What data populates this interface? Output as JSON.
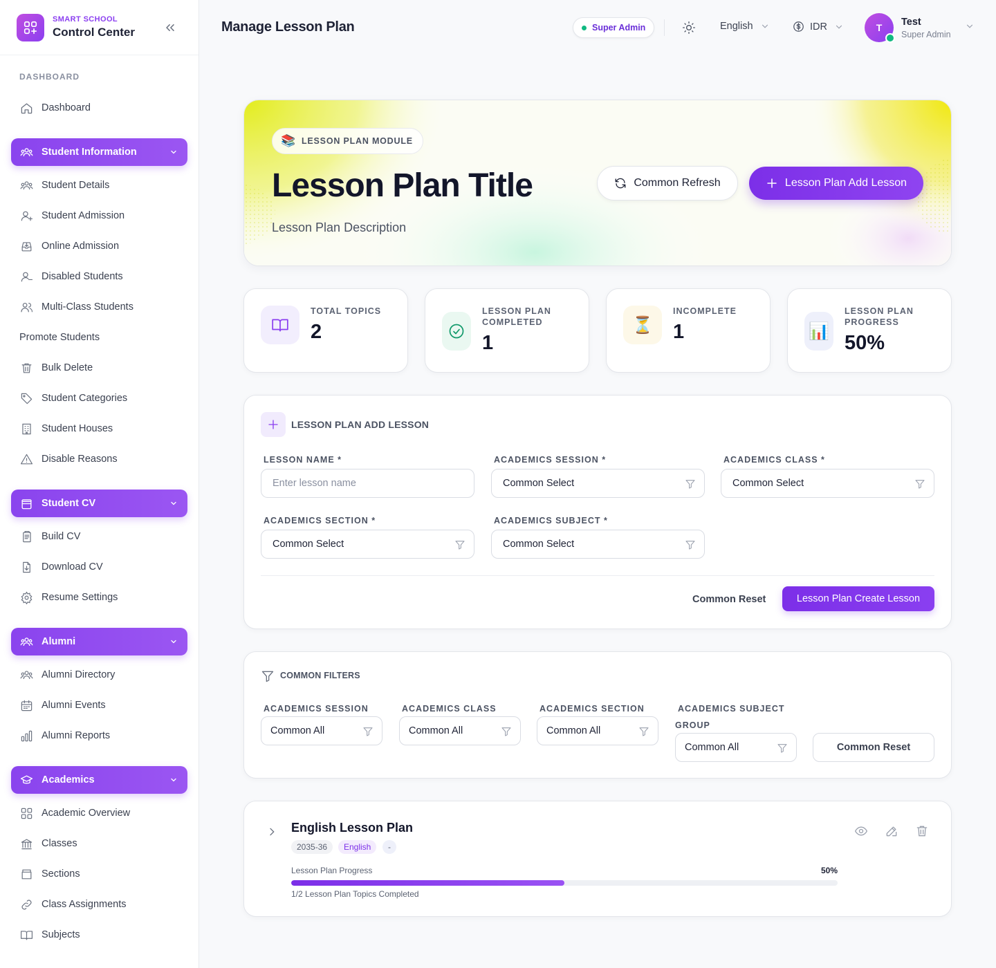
{
  "brand": {
    "small": "SMART SCHOOL",
    "big": "Control Center"
  },
  "sidebar": {
    "section_label": "DASHBOARD",
    "dashboard": "Dashboard",
    "groups": [
      {
        "label": "Student Information",
        "items": [
          "Student Details",
          "Student Admission",
          "Online Admission",
          "Disabled Students",
          "Multi-Class Students",
          "Promote Students",
          "Bulk Delete",
          "Student Categories",
          "Student Houses",
          "Disable Reasons"
        ]
      },
      {
        "label": "Student CV",
        "items": [
          "Build CV",
          "Download CV",
          "Resume Settings"
        ]
      },
      {
        "label": "Alumni",
        "items": [
          "Alumni Directory",
          "Alumni Events",
          "Alumni Reports"
        ]
      },
      {
        "label": "Academics",
        "items": [
          "Academic Overview",
          "Classes",
          "Sections",
          "Class Assignments",
          "Subjects"
        ]
      }
    ]
  },
  "header": {
    "title": "Manage Lesson Plan",
    "role_badge": "Super Admin",
    "language": "English",
    "currency": "IDR",
    "user": {
      "initial": "T",
      "name": "Test",
      "role": "Super Admin"
    }
  },
  "hero": {
    "badge_emoji": "📚",
    "badge": "LESSON PLAN MODULE",
    "title": "Lesson Plan Title",
    "description": "Lesson Plan Description",
    "refresh_label": "Common Refresh",
    "add_label": "Lesson Plan Add Lesson"
  },
  "stats": [
    {
      "label": "TOTAL TOPICS",
      "value": "2",
      "icon": "book-icon"
    },
    {
      "label": "LESSON PLAN COMPLETED",
      "value": "1",
      "icon": "check-circle-icon"
    },
    {
      "label": "INCOMPLETE",
      "value": "1",
      "icon": "⏳"
    },
    {
      "label": "LESSON PLAN PROGRESS",
      "value": "50%",
      "icon": "📊"
    }
  ],
  "add_form": {
    "title": "LESSON PLAN ADD LESSON",
    "lesson_name_label": "LESSON NAME *",
    "lesson_name_placeholder": "Enter lesson name",
    "session_label": "ACADEMICS SESSION *",
    "session_value": "Common Select",
    "class_label": "ACADEMICS CLASS *",
    "class_value": "Common Select",
    "section_label": "ACADEMICS SECTION *",
    "section_value": "Common Select",
    "subject_label": "ACADEMICS SUBJECT *",
    "subject_value": "Common Select",
    "reset_label": "Common Reset",
    "create_label": "Lesson Plan Create Lesson"
  },
  "filters": {
    "title": "COMMON FILTERS",
    "session_label": "ACADEMICS SESSION",
    "session_value": "Common All",
    "class_label": "ACADEMICS CLASS",
    "class_value": "Common All",
    "section_label": "ACADEMICS SECTION",
    "section_value": "Common All",
    "subject_group_label_1": "ACADEMICS SUBJECT",
    "subject_group_label_2": "GROUP",
    "subject_group_value": "Common All",
    "reset_label": "Common Reset"
  },
  "lesson": {
    "title": "English Lesson Plan",
    "tags": [
      "2035-36",
      "English",
      "-"
    ],
    "progress_label": "Lesson Plan Progress",
    "progress_pct_text": "50%",
    "progress_fraction": 0.5,
    "completed_text": "1/2 Lesson Plan Topics Completed"
  },
  "colors": {
    "accent": "#7c2fe8",
    "success": "#10b981"
  }
}
